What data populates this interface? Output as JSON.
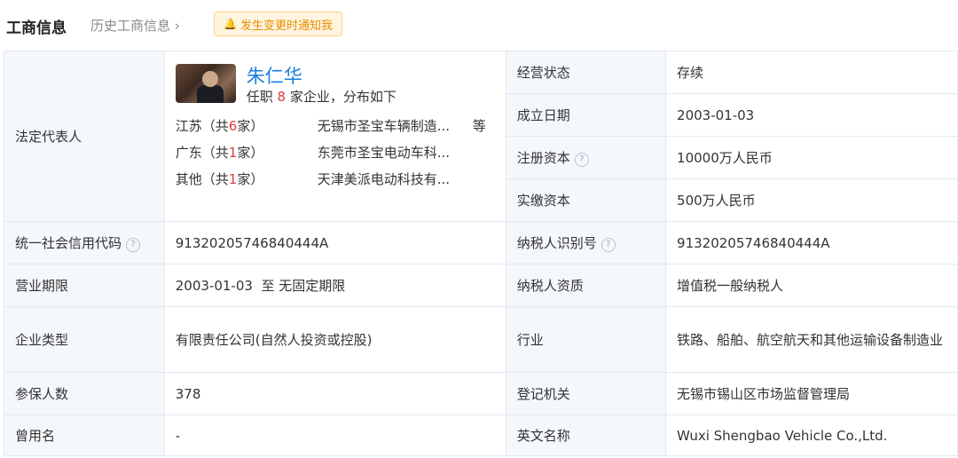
{
  "header": {
    "title": "工商信息",
    "history_link": "历史工商信息",
    "notify_button": "发生变更时通知我"
  },
  "legal_rep": {
    "label": "法定代表人",
    "name": "朱仁华",
    "positions_prefix": "任职 ",
    "positions_count": "8",
    "positions_suffix": " 家企业，分布如下",
    "distribution": [
      {
        "region_prefix": "江苏（共",
        "count": "6",
        "region_suffix": "家）",
        "company": "无锡市圣宝车辆制造...",
        "more": "等"
      },
      {
        "region_prefix": "广东（共",
        "count": "1",
        "region_suffix": "家）",
        "company": "东莞市圣宝电动车科...",
        "more": ""
      },
      {
        "region_prefix": "其他（共",
        "count": "1",
        "region_suffix": "家）",
        "company": "天津美派电动科技有...",
        "more": ""
      }
    ]
  },
  "right_top": [
    {
      "label": "经营状态",
      "value": "存续",
      "help": false
    },
    {
      "label": "成立日期",
      "value": "2003-01-03",
      "help": false
    },
    {
      "label": "注册资本",
      "value": "10000万人民币",
      "help": true
    },
    {
      "label": "实缴资本",
      "value": "500万人民币",
      "help": false
    }
  ],
  "rows": [
    {
      "l1": "统一社会信用代码",
      "h1": true,
      "v1": "91320205746840444A",
      "l2": "纳税人识别号",
      "h2": true,
      "v2": "91320205746840444A"
    },
    {
      "l1": "营业期限",
      "h1": false,
      "v1": "2003-01-03  至 无固定期限",
      "l2": "纳税人资质",
      "h2": false,
      "v2": "增值税一般纳税人"
    },
    {
      "l1": "企业类型",
      "h1": false,
      "v1": "有限责任公司(自然人投资或控股)",
      "l2": "行业",
      "h2": false,
      "v2": "铁路、船舶、航空航天和其他运输设备制造业"
    },
    {
      "l1": "参保人数",
      "h1": false,
      "v1": "378",
      "l2": "登记机关",
      "h2": false,
      "v2": "无锡市锡山区市场监督管理局"
    },
    {
      "l1": "曾用名",
      "h1": false,
      "v1": "-",
      "l2": "英文名称",
      "h2": false,
      "v2": "Wuxi Shengbao Vehicle Co.,Ltd."
    }
  ],
  "help_glyph": "?",
  "icons": {
    "bell": "bell-icon",
    "chevron": "chevron-right-icon",
    "help": "question-circle-icon"
  }
}
